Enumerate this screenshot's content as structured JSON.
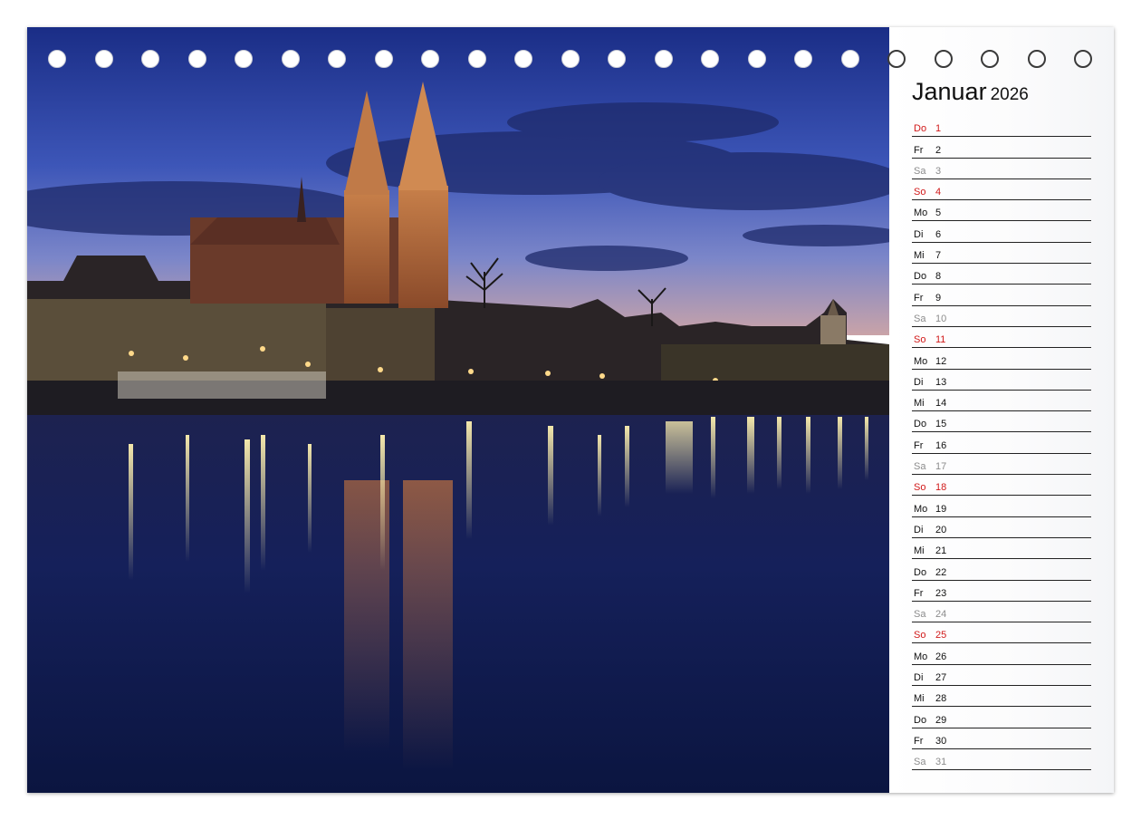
{
  "calendar": {
    "month": "Januar",
    "year": "2026",
    "days": [
      {
        "dn": "Do",
        "d": "1",
        "kind": "sun"
      },
      {
        "dn": "Fr",
        "d": "2",
        "kind": "wd"
      },
      {
        "dn": "Sa",
        "d": "3",
        "kind": "sat"
      },
      {
        "dn": "So",
        "d": "4",
        "kind": "sun"
      },
      {
        "dn": "Mo",
        "d": "5",
        "kind": "wd"
      },
      {
        "dn": "Di",
        "d": "6",
        "kind": "wd"
      },
      {
        "dn": "Mi",
        "d": "7",
        "kind": "wd"
      },
      {
        "dn": "Do",
        "d": "8",
        "kind": "wd"
      },
      {
        "dn": "Fr",
        "d": "9",
        "kind": "wd"
      },
      {
        "dn": "Sa",
        "d": "10",
        "kind": "sat"
      },
      {
        "dn": "So",
        "d": "11",
        "kind": "sun"
      },
      {
        "dn": "Mo",
        "d": "12",
        "kind": "wd"
      },
      {
        "dn": "Di",
        "d": "13",
        "kind": "wd"
      },
      {
        "dn": "Mi",
        "d": "14",
        "kind": "wd"
      },
      {
        "dn": "Do",
        "d": "15",
        "kind": "wd"
      },
      {
        "dn": "Fr",
        "d": "16",
        "kind": "wd"
      },
      {
        "dn": "Sa",
        "d": "17",
        "kind": "sat"
      },
      {
        "dn": "So",
        "d": "18",
        "kind": "sun"
      },
      {
        "dn": "Mo",
        "d": "19",
        "kind": "wd"
      },
      {
        "dn": "Di",
        "d": "20",
        "kind": "wd"
      },
      {
        "dn": "Mi",
        "d": "21",
        "kind": "wd"
      },
      {
        "dn": "Do",
        "d": "22",
        "kind": "wd"
      },
      {
        "dn": "Fr",
        "d": "23",
        "kind": "wd"
      },
      {
        "dn": "Sa",
        "d": "24",
        "kind": "sat"
      },
      {
        "dn": "So",
        "d": "25",
        "kind": "sun"
      },
      {
        "dn": "Mo",
        "d": "26",
        "kind": "wd"
      },
      {
        "dn": "Di",
        "d": "27",
        "kind": "wd"
      },
      {
        "dn": "Mi",
        "d": "28",
        "kind": "wd"
      },
      {
        "dn": "Do",
        "d": "29",
        "kind": "wd"
      },
      {
        "dn": "Fr",
        "d": "30",
        "kind": "wd"
      },
      {
        "dn": "Sa",
        "d": "31",
        "kind": "sat"
      }
    ]
  },
  "binding_holes": 23,
  "colors": {
    "sunday_holiday": "#d11a1a",
    "saturday": "#8c8c8c",
    "weekday": "#111111",
    "sky_top": "#1b2f8a",
    "water": "#0e1640"
  }
}
